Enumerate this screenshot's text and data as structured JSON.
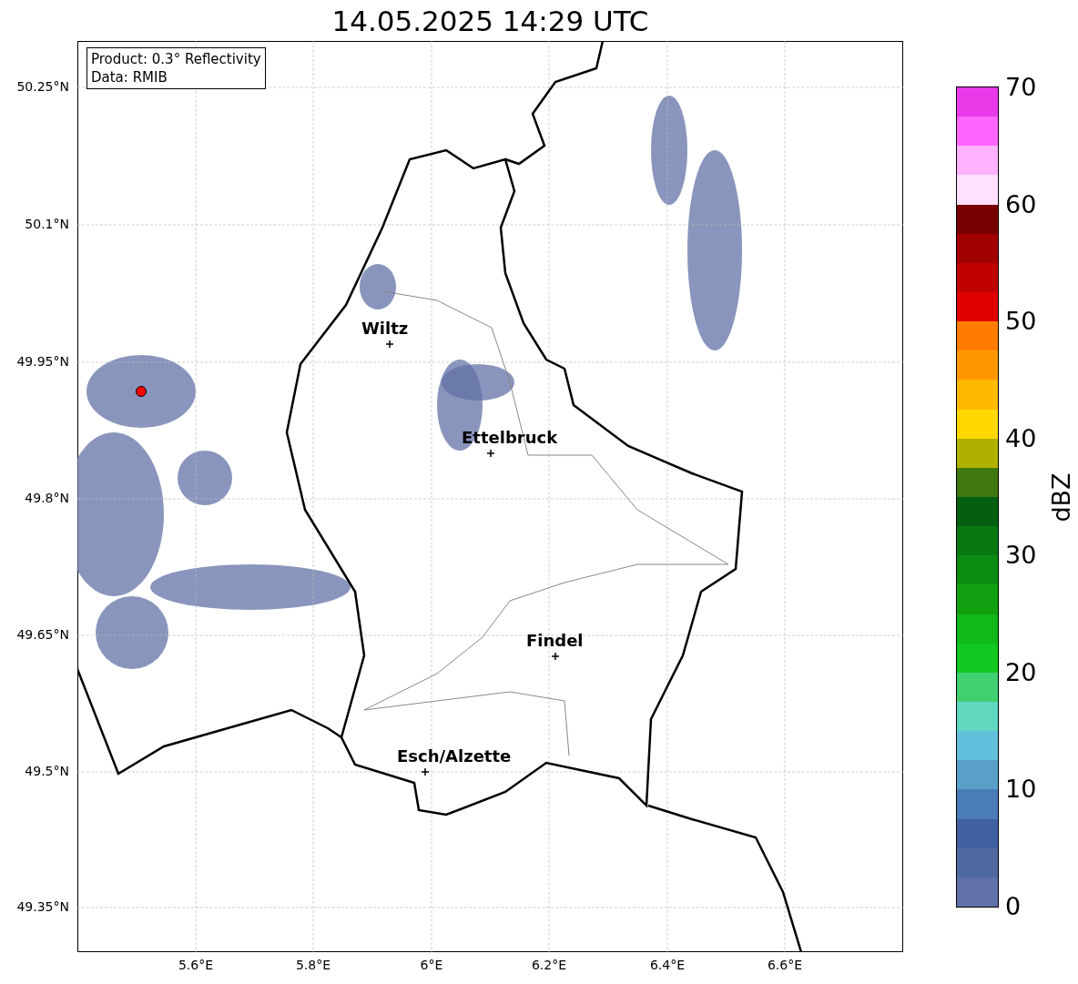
{
  "title": "14.05.2025 14:29 UTC",
  "info_box": [
    "Product: 0.3° Reflectivity",
    "Data: RMIB"
  ],
  "map": {
    "y_ticks": [
      "50.25°N",
      "50.1°N",
      "49.95°N",
      "49.8°N",
      "49.65°N",
      "49.5°N",
      "49.35°N"
    ],
    "x_ticks": [
      "5.6°E",
      "5.8°E",
      "6°E",
      "6.2°E",
      "6.4°E",
      "6.6°E"
    ],
    "cities": [
      {
        "name": "Wiltz"
      },
      {
        "name": "Ettelbruck"
      },
      {
        "name": "Findel"
      },
      {
        "name": "Esch/Alzette"
      }
    ]
  },
  "colorbar": {
    "label": "dBZ",
    "ticks": [
      "70",
      "60",
      "50",
      "40",
      "30",
      "20",
      "10",
      "0"
    ]
  }
}
